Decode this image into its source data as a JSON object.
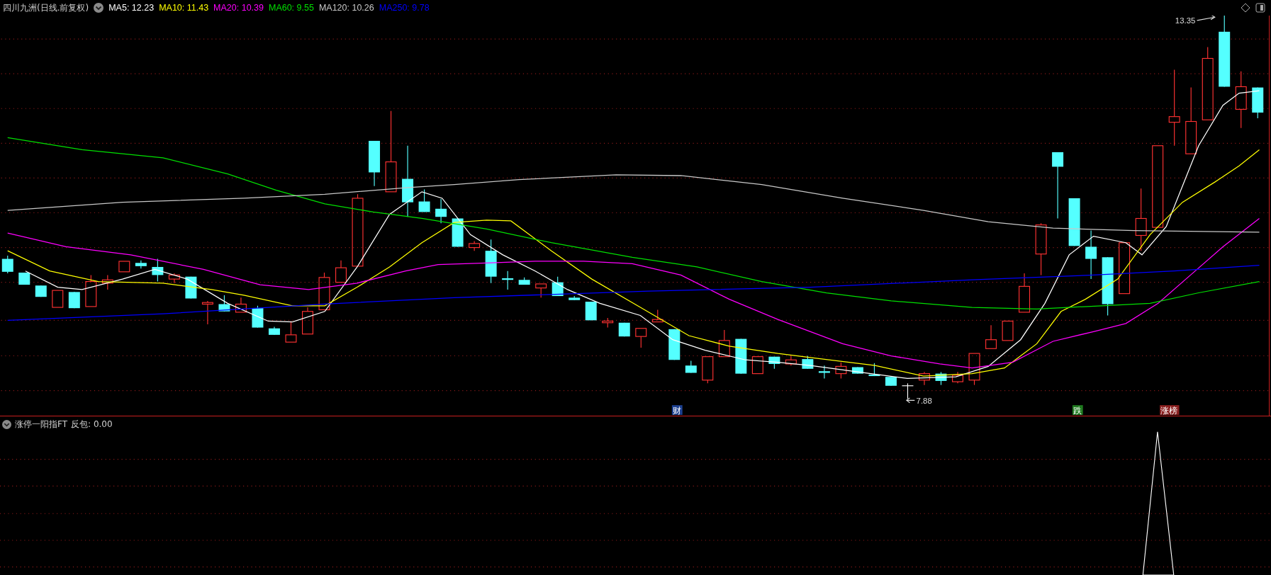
{
  "header": {
    "title": "四川九洲(日线.前复权)",
    "indicators": [
      {
        "label": "MA5: 12.23",
        "color": "#ffffff"
      },
      {
        "label": "MA10: 11.43",
        "color": "#ffff00"
      },
      {
        "label": "MA20: 10.39",
        "color": "#ff00ff"
      },
      {
        "label": "MA60: 9.55",
        "color": "#00e000"
      },
      {
        "label": "MA120: 10.26",
        "color": "#c8c8c8"
      },
      {
        "label": "MA250: 9.78",
        "color": "#0000ff"
      }
    ]
  },
  "chart": {
    "high_label": "13.35",
    "low_label": "7.88",
    "markers": [
      {
        "text": "财",
        "color": "#1c3f8f"
      },
      {
        "text": "跌",
        "color": "#1f7a1f"
      },
      {
        "text": "涨榜",
        "color": "#8a1f1f"
      }
    ]
  },
  "sub_panel": {
    "title": "涨停一阳指FT",
    "readout": "反包: 0.00"
  }
}
